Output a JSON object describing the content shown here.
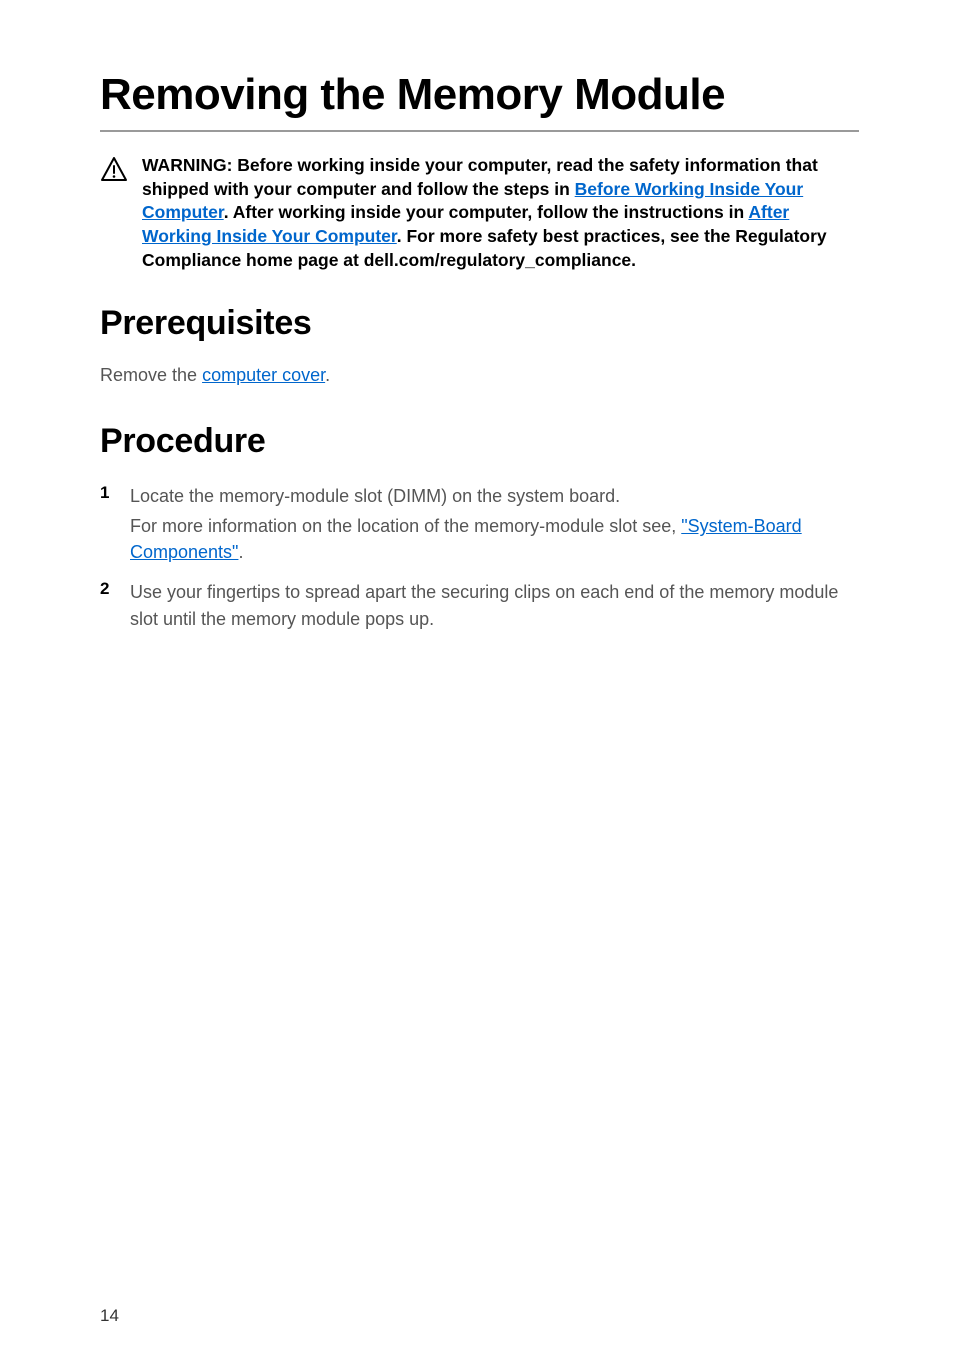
{
  "title": "Removing the Memory Module",
  "warning": {
    "pre_link1": "WARNING: Before working inside your computer, read the safety information that shipped with your computer and follow the steps in ",
    "link1": "Before Working Inside Your Computer",
    "post_link1_pre_link2": ". After working inside your computer, follow the instructions in ",
    "link2": "After Working Inside Your Computer",
    "post_link2": ". For more safety best practices, see the Regulatory Compliance home page at dell.com/regulatory_compliance."
  },
  "sections": {
    "prerequisites": {
      "heading": "Prerequisites",
      "text_pre": "Remove the ",
      "link": "computer cover",
      "text_post": "."
    },
    "procedure": {
      "heading": "Procedure",
      "steps": [
        {
          "line1": "Locate the memory-module slot (DIMM) on the system board.",
          "line2_pre": "For more information on the location of the memory-module slot see, ",
          "line2_link": "\"System-Board Components\"",
          "line2_post": "."
        },
        {
          "line1": "Use your fingertips to spread apart the securing clips on each end of the memory module slot until the memory module pops up."
        }
      ]
    }
  },
  "page_number": "14"
}
